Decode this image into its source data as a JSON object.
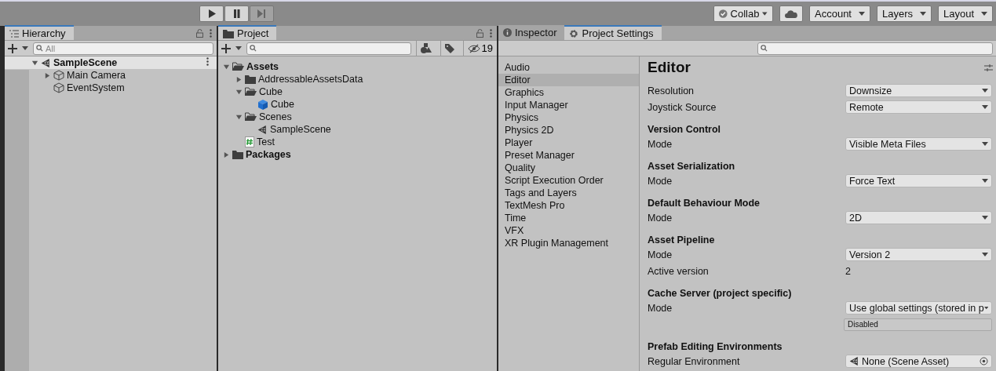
{
  "toolbar": {
    "play_controls": [
      {
        "kind": "play",
        "disabled": false
      },
      {
        "kind": "pause",
        "disabled": false
      },
      {
        "kind": "step",
        "disabled": true
      }
    ],
    "right_buttons": [
      {
        "kind": "collab",
        "label": "Collab"
      },
      {
        "kind": "cloud"
      },
      {
        "kind": "menu",
        "label": "Account"
      },
      {
        "kind": "menu",
        "label": "Layers"
      },
      {
        "kind": "menu",
        "label": "Layout"
      }
    ]
  },
  "hierarchy": {
    "tab": "Hierarchy",
    "search": {
      "placeholder": "All"
    },
    "tree": [
      {
        "label": "SampleScene",
        "kind": "scene",
        "expanded": true,
        "selected": true,
        "children": [
          {
            "label": "Main Camera",
            "kind": "gameobject",
            "expanded": false,
            "selected": false
          },
          {
            "label": "EventSystem",
            "kind": "gameobject",
            "selected": false
          }
        ]
      }
    ]
  },
  "project": {
    "tab": "Project",
    "hidden_count": "19",
    "tree": [
      {
        "label": "Assets",
        "kind": "folder",
        "expanded": true,
        "children": [
          {
            "label": "AddressableAssetsData",
            "kind": "folder",
            "expanded": false
          },
          {
            "label": "Cube",
            "kind": "folder",
            "expanded": true,
            "children": [
              {
                "label": "Cube",
                "kind": "prefab"
              }
            ]
          },
          {
            "label": "Scenes",
            "kind": "folder",
            "expanded": true,
            "children": [
              {
                "label": "SampleScene",
                "kind": "scene"
              }
            ]
          },
          {
            "label": "Test",
            "kind": "script"
          }
        ]
      },
      {
        "label": "Packages",
        "kind": "folder",
        "expanded": false
      }
    ]
  },
  "settings_window": {
    "tabs": [
      {
        "label": "Inspector",
        "kind": "info",
        "selected": false
      },
      {
        "label": "Project Settings",
        "kind": "gear",
        "selected": true
      }
    ],
    "categories": [
      {
        "label": "Audio",
        "selected": false
      },
      {
        "label": "Editor",
        "selected": true
      },
      {
        "label": "Graphics",
        "selected": false
      },
      {
        "label": "Input Manager",
        "selected": false
      },
      {
        "label": "Physics",
        "selected": false
      },
      {
        "label": "Physics 2D",
        "selected": false
      },
      {
        "label": "Player",
        "selected": false
      },
      {
        "label": "Preset Manager",
        "selected": false
      },
      {
        "label": "Quality",
        "selected": false
      },
      {
        "label": "Script Execution Order",
        "selected": false
      },
      {
        "label": "Tags and Layers",
        "selected": false
      },
      {
        "label": "TextMesh Pro",
        "selected": false
      },
      {
        "label": "Time",
        "selected": false
      },
      {
        "label": "VFX",
        "selected": false
      },
      {
        "label": "XR Plugin Management",
        "selected": false
      }
    ],
    "title": "Editor",
    "sections": [
      {
        "rows": [
          {
            "label": "Resolution",
            "kind": "dropdown",
            "value": "Downsize"
          },
          {
            "label": "Joystick Source",
            "kind": "dropdown",
            "value": "Remote"
          }
        ]
      },
      {
        "title": "Version Control",
        "rows": [
          {
            "label": "Mode",
            "kind": "dropdown",
            "value": "Visible Meta Files"
          }
        ]
      },
      {
        "title": "Asset Serialization",
        "rows": [
          {
            "label": "Mode",
            "kind": "dropdown",
            "value": "Force Text"
          }
        ]
      },
      {
        "title": "Default Behaviour Mode",
        "rows": [
          {
            "label": "Mode",
            "kind": "dropdown",
            "value": "2D"
          }
        ]
      },
      {
        "title": "Asset Pipeline",
        "rows": [
          {
            "label": "Mode",
            "kind": "dropdown",
            "value": "Version 2"
          },
          {
            "label": "Active version",
            "kind": "text",
            "value": "2"
          }
        ]
      },
      {
        "title": "Cache Server (project specific)",
        "rows": [
          {
            "label": "Mode",
            "kind": "dropdown",
            "value": "Use global settings (stored in p"
          },
          {
            "kind": "status",
            "value": "Disabled"
          }
        ]
      },
      {
        "title": "Prefab Editing Environments",
        "rows": [
          {
            "label": "Regular Environment",
            "kind": "object",
            "value": "None (Scene Asset)"
          }
        ]
      }
    ]
  }
}
